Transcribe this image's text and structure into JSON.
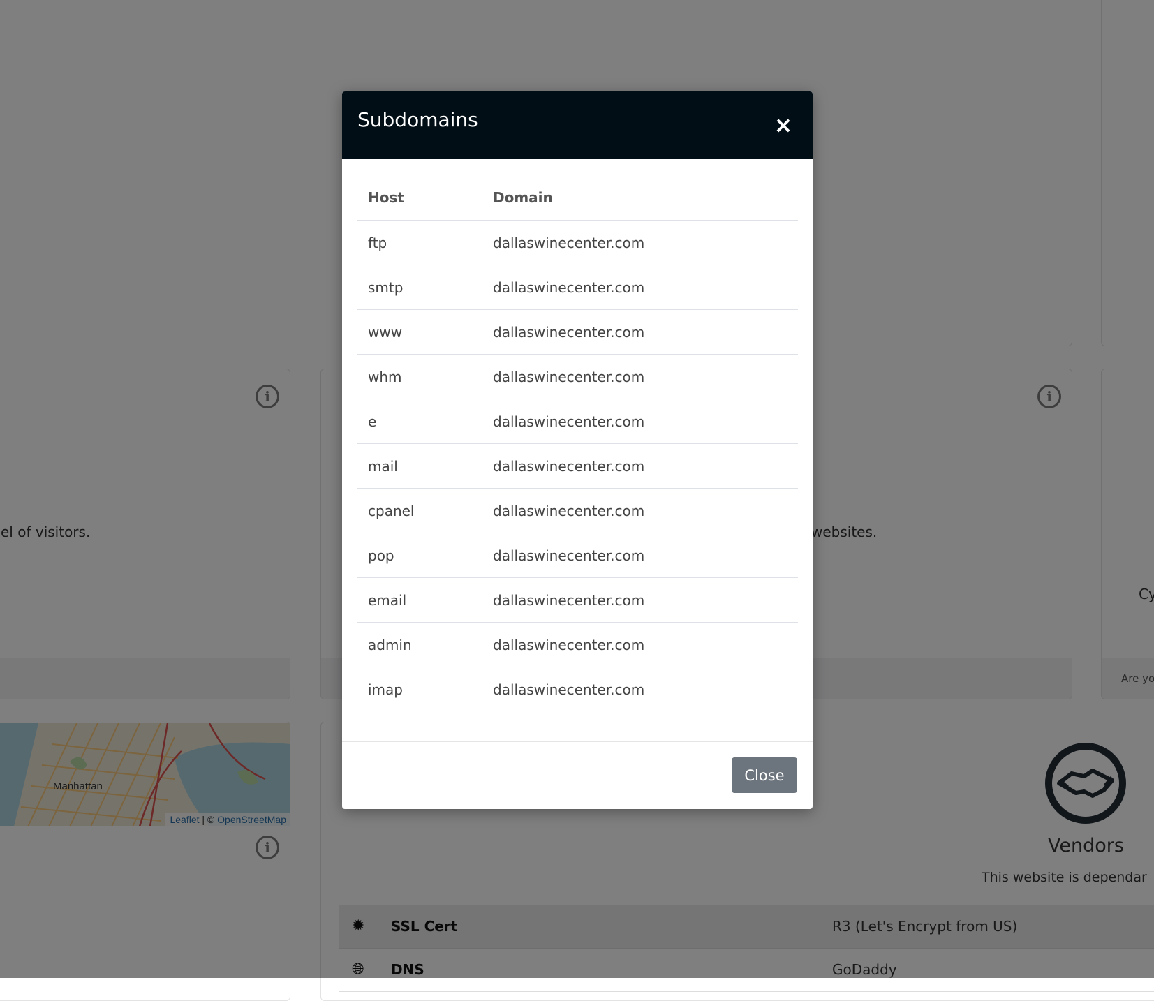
{
  "background": {
    "card_left_text": "el of visitors.",
    "card_mid_text": "websites.",
    "card_right_text": "Cy",
    "card_right_footer": "Are yo",
    "map": {
      "place_label": "Manhattan",
      "attribution_leaflet": "Leaflet",
      "attribution_sep": " | © ",
      "attribution_osm": "OpenStreetMap"
    },
    "vendors": {
      "title": "Vendors",
      "description": "This website is dependar",
      "rows": [
        {
          "icon": "certificate-icon",
          "label": "SSL Cert",
          "value": "R3 (Let's Encrypt from US)"
        },
        {
          "icon": "globe-icon",
          "label": "DNS",
          "value": "GoDaddy"
        }
      ]
    }
  },
  "modal": {
    "title": "Subdomains",
    "close_icon": "×",
    "columns": {
      "host": "Host",
      "domain": "Domain"
    },
    "rows": [
      {
        "host": "ftp",
        "domain": "dallaswinecenter.com"
      },
      {
        "host": "smtp",
        "domain": "dallaswinecenter.com"
      },
      {
        "host": "www",
        "domain": "dallaswinecenter.com"
      },
      {
        "host": "whm",
        "domain": "dallaswinecenter.com"
      },
      {
        "host": "e",
        "domain": "dallaswinecenter.com"
      },
      {
        "host": "mail",
        "domain": "dallaswinecenter.com"
      },
      {
        "host": "cpanel",
        "domain": "dallaswinecenter.com"
      },
      {
        "host": "pop",
        "domain": "dallaswinecenter.com"
      },
      {
        "host": "email",
        "domain": "dallaswinecenter.com"
      },
      {
        "host": "admin",
        "domain": "dallaswinecenter.com"
      },
      {
        "host": "imap",
        "domain": "dallaswinecenter.com"
      }
    ],
    "close_button": "Close"
  },
  "colors": {
    "modal_header": "#020e16",
    "close_button": "#6c757d",
    "backdrop": "rgba(0,0,0,0.5)"
  }
}
